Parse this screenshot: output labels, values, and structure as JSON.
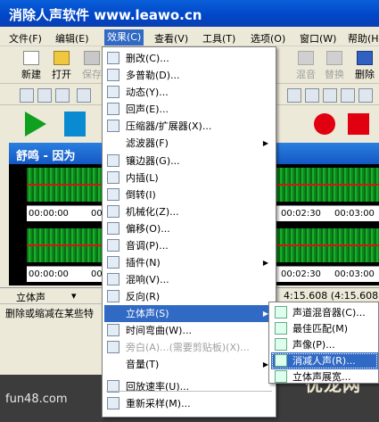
{
  "window": {
    "title": "消除人声软件 www.leawo.cn"
  },
  "menubar": [
    {
      "label": "文件(F)"
    },
    {
      "label": "编辑(E)"
    },
    {
      "label": "效果(C)"
    },
    {
      "label": "查看(V)"
    },
    {
      "label": "工具(T)"
    },
    {
      "label": "选项(O)"
    },
    {
      "label": "窗口(W)"
    },
    {
      "label": "帮助(H)"
    }
  ],
  "toolbar": {
    "new": "新建",
    "open": "打开",
    "save": "保存",
    "mix": "混音",
    "replace": "替换",
    "delete": "删除"
  },
  "document": {
    "title": "舒鸣 - 因为"
  },
  "ruler": {
    "top": [
      "00:00:00",
      "00:00:30",
      "00:02:30",
      "00:03:00"
    ],
    "bottom": [
      "00:00:00",
      "00:00:30",
      "00:02:30",
      "00:03:00"
    ]
  },
  "status": {
    "channel_mode": "立体声",
    "time": "4:15.608 (4:15.608)",
    "hint": "删除或缩减在某些特"
  },
  "effects_menu": {
    "items": [
      {
        "icon": "delete-icon",
        "label": "删改(C)...",
        "arrow": false
      },
      {
        "icon": "multi-tone-icon",
        "label": "多普勒(D)...",
        "arrow": false
      },
      {
        "icon": "dynamic-icon",
        "label": "动态(Y)...",
        "arrow": false
      },
      {
        "icon": "echo-icon",
        "label": "回声(E)...",
        "arrow": false
      },
      {
        "icon": "compressor-icon",
        "label": "压缩器/扩展器(X)...",
        "arrow": false
      },
      {
        "icon": "",
        "label": "滤波器(F)",
        "arrow": true
      },
      {
        "icon": "flanger-icon",
        "label": "镶边器(G)...",
        "arrow": false
      },
      {
        "icon": "interpolate-icon",
        "label": "内插(L)",
        "arrow": false
      },
      {
        "icon": "reverse-icon",
        "label": "倒转(I)",
        "arrow": false
      },
      {
        "icon": "mechanize-icon",
        "label": "机械化(Z)...",
        "arrow": false
      },
      {
        "icon": "shift-icon",
        "label": "偏移(O)...",
        "arrow": false
      },
      {
        "icon": "tone-icon",
        "label": "音调(P)...",
        "arrow": false
      },
      {
        "icon": "plugin-icon",
        "label": "插件(N)",
        "arrow": true
      },
      {
        "icon": "reverb-icon",
        "label": "混响(V)...",
        "arrow": false
      },
      {
        "icon": "reverse-arrow-icon",
        "label": "反向(R)",
        "arrow": false
      },
      {
        "icon": "",
        "label": "立体声(S)",
        "arrow": true,
        "highlight": true
      },
      {
        "icon": "time-warp-icon",
        "label": "时间弯曲(W)...",
        "arrow": false
      },
      {
        "icon": "narrate-icon",
        "label": "旁白(A)...(需要剪贴板)(X)...",
        "arrow": false,
        "disabled": true
      },
      {
        "icon": "",
        "label": "音量(T)",
        "arrow": true
      },
      {
        "icon": "playback-rate-icon",
        "label": "回放速率(U)...",
        "arrow": false
      },
      {
        "icon": "resample-icon",
        "label": "重新采样(M)...",
        "arrow": false
      }
    ]
  },
  "stereo_submenu": {
    "items": [
      {
        "label": "声道混音器(C)..."
      },
      {
        "label": "最佳匹配(M)"
      },
      {
        "label": "声像(P)..."
      },
      {
        "label": "消减人声(R)...",
        "highlight": true
      },
      {
        "label": "立体声展宽..."
      }
    ]
  },
  "footer": {
    "site": "fun48.com",
    "watermark": "优龙网"
  }
}
